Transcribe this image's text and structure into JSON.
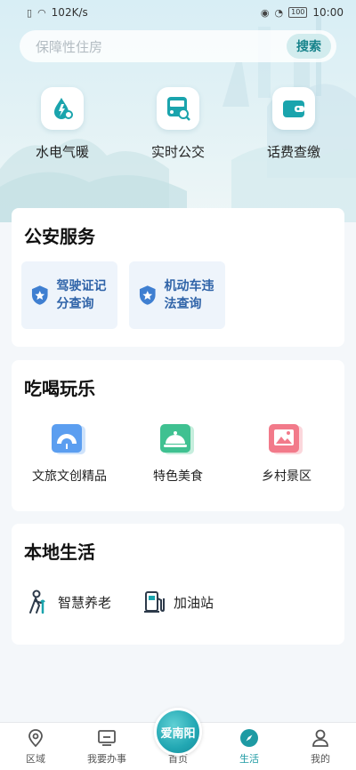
{
  "status_bar": {
    "speed": "102K/s",
    "battery": "100",
    "time": "10:00"
  },
  "search": {
    "placeholder": "保障性住房",
    "button_label": "搜索"
  },
  "quick_services": [
    {
      "label": "水电气暖",
      "icon": "water-drop-icon"
    },
    {
      "label": "实时公交",
      "icon": "bus-icon"
    },
    {
      "label": "话费查缴",
      "icon": "wallet-icon"
    }
  ],
  "police": {
    "title": "公安服务",
    "items": [
      {
        "label": "驾驶证记分查询",
        "icon": "shield-star-icon"
      },
      {
        "label": "机动车违法查询",
        "icon": "shield-star-icon"
      }
    ]
  },
  "fun": {
    "title": "吃喝玩乐",
    "items": [
      {
        "label": "文旅文创精品",
        "icon": "fan-icon"
      },
      {
        "label": "特色美食",
        "icon": "cloche-icon"
      },
      {
        "label": "乡村景区",
        "icon": "landscape-icon"
      }
    ]
  },
  "local": {
    "title": "本地生活",
    "items": [
      {
        "label": "智慧养老",
        "icon": "elderly-icon"
      },
      {
        "label": "加油站",
        "icon": "fuel-pump-icon"
      }
    ]
  },
  "tabbar": {
    "center_logo": "爱南阳",
    "tabs": [
      {
        "label": "区域",
        "icon": "location-pin-icon"
      },
      {
        "label": "我要办事",
        "icon": "monitor-icon"
      },
      {
        "label": "首页",
        "icon": "home-logo-icon"
      },
      {
        "label": "生活",
        "icon": "compass-icon"
      },
      {
        "label": "我的",
        "icon": "user-icon"
      }
    ],
    "active_tab": "生活"
  },
  "colors": {
    "accent": "#1d9aa3",
    "police_text": "#2f63a8",
    "hero_bg": "#dcf0f5"
  }
}
